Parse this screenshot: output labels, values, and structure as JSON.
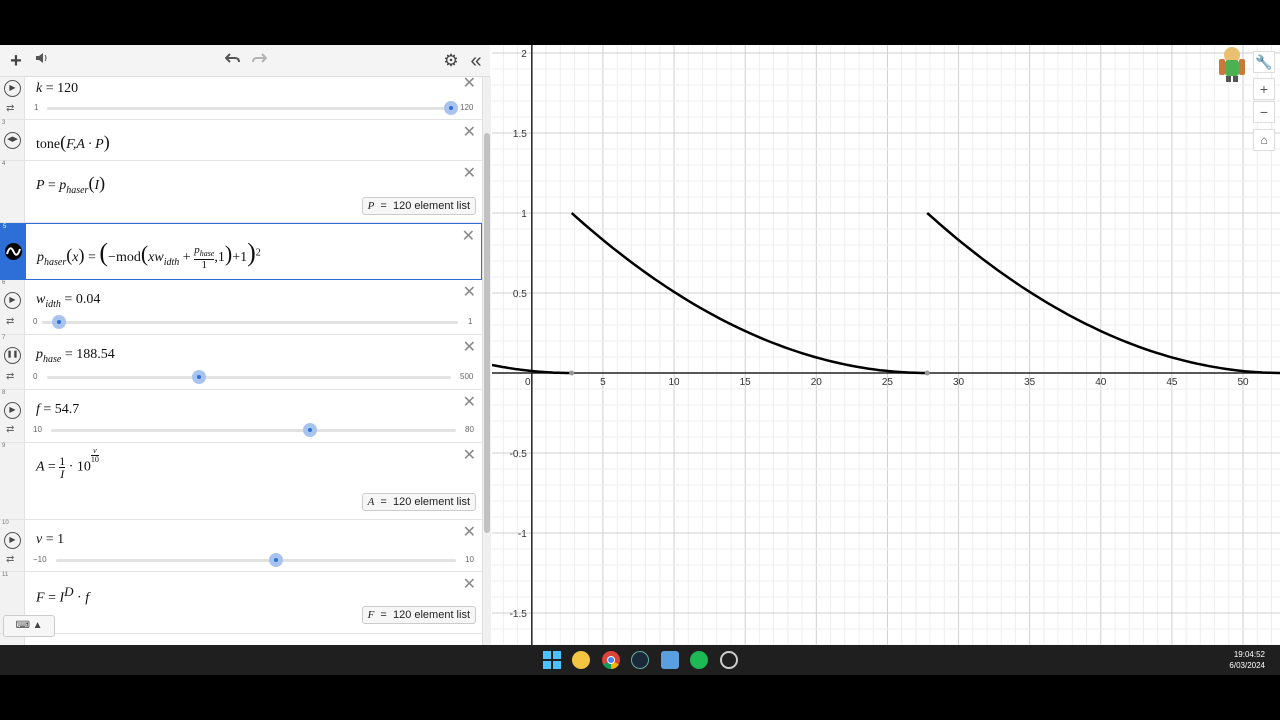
{
  "toolbar": {
    "add_icon": "plus-icon",
    "audio_icon": "speaker-icon",
    "undo_icon": "undo-icon",
    "redo_icon": "redo-icon",
    "settings_icon": "gear-icon",
    "collapse_icon": "double-chevron-left-icon"
  },
  "expressions": [
    {
      "index": "",
      "latex": "k = 120",
      "slider": {
        "min": "1",
        "max": "120",
        "value": 120,
        "min_num": 1,
        "max_num": 120
      }
    },
    {
      "index": "3",
      "latex": "tone(F,A · P)"
    },
    {
      "index": "4",
      "latex": "P = p_haser(I)",
      "list_badge": {
        "name": "P",
        "text": "120 element list"
      }
    },
    {
      "index": "5",
      "latex": "p_haser(x) = (−mod(xw_idth + p_hase/1, 1) + 1)^2",
      "active": true
    },
    {
      "index": "6",
      "latex": "w_idth = 0.04",
      "slider": {
        "min": "0",
        "max": "1",
        "value": 0.04,
        "min_num": 0,
        "max_num": 1
      }
    },
    {
      "index": "7",
      "latex": "p_hase = 188.54",
      "slider": {
        "min": "0",
        "max": "500",
        "value": 188.54,
        "min_num": 0,
        "max_num": 500
      },
      "playing": true
    },
    {
      "index": "8",
      "latex": "f = 54.7",
      "slider": {
        "min": "10",
        "max": "80",
        "value": 54.7,
        "min_num": 10,
        "max_num": 80
      }
    },
    {
      "index": "9",
      "latex": "A = 1/I · 10^(v/10)",
      "list_badge": {
        "name": "A",
        "text": "120 element list"
      }
    },
    {
      "index": "10",
      "latex": "v = 1",
      "slider": {
        "min": "−10",
        "max": "10",
        "value": 1,
        "min_num": -10,
        "max_num": 10
      }
    },
    {
      "index": "11",
      "latex": "F = I^D · f",
      "list_badge": {
        "name": "F",
        "text": "120 element list"
      }
    }
  ],
  "text": {
    "k_var": "k",
    "k_val": "120",
    "tone_fn": "tone",
    "tone_args": "F,A · P",
    "p_lhs": "P",
    "p_fn": "p",
    "p_sub": "haser",
    "p_arg": "I",
    "ph_fn": "p",
    "ph_sub": "haser",
    "ph_arg": "x",
    "ph_mod": "mod",
    "ph_x": "xw",
    "ph_xsub": "idth",
    "ph_num": "p",
    "ph_numsub": "hase",
    "ph_den": "1",
    "ph_one": "1",
    "ph_plus1": "+1",
    "ph_exp": "2",
    "w_var": "w",
    "w_sub": "idth",
    "w_val": "0.04",
    "phase_var": "p",
    "phase_sub": "hase",
    "phase_val": "188.54",
    "f_var": "f",
    "f_val": "54.7",
    "a_lhs": "A",
    "a_num": "1",
    "a_den": "I",
    "a_ten": "10",
    "a_enum": "v",
    "a_eden": "10",
    "v_var": "v",
    "v_val": "1",
    "F_lhs": "F",
    "F_I": "I",
    "F_D": "D",
    "F_f": "f",
    "eq": "="
  },
  "graph": {
    "x_ticks": [
      "0",
      "5",
      "10",
      "15",
      "20",
      "25",
      "30",
      "35",
      "40",
      "45",
      "50"
    ],
    "y_ticks": [
      "2",
      "1.5",
      "1",
      "0.5",
      "-0.5",
      "-1",
      "-1.5"
    ],
    "x_range": [
      -2.8,
      52.6
    ],
    "y_range": [
      -1.7,
      2.05
    ],
    "grid": true,
    "curve_color": "#000000"
  },
  "graph_controls": {
    "wrench_icon": "wrench-icon",
    "zoom_in": "+",
    "zoom_out": "−",
    "home_icon": "home-icon"
  },
  "keyboard": {
    "icon": "keyboard-icon",
    "caret": "▲"
  },
  "taskbar": {
    "icons": [
      "windows-start-icon",
      "file-explorer-icon",
      "chrome-icon",
      "steam-icon",
      "photos-icon",
      "spotify-icon",
      "obs-icon"
    ],
    "time": "19:04:52",
    "date": "6/03/2024"
  }
}
